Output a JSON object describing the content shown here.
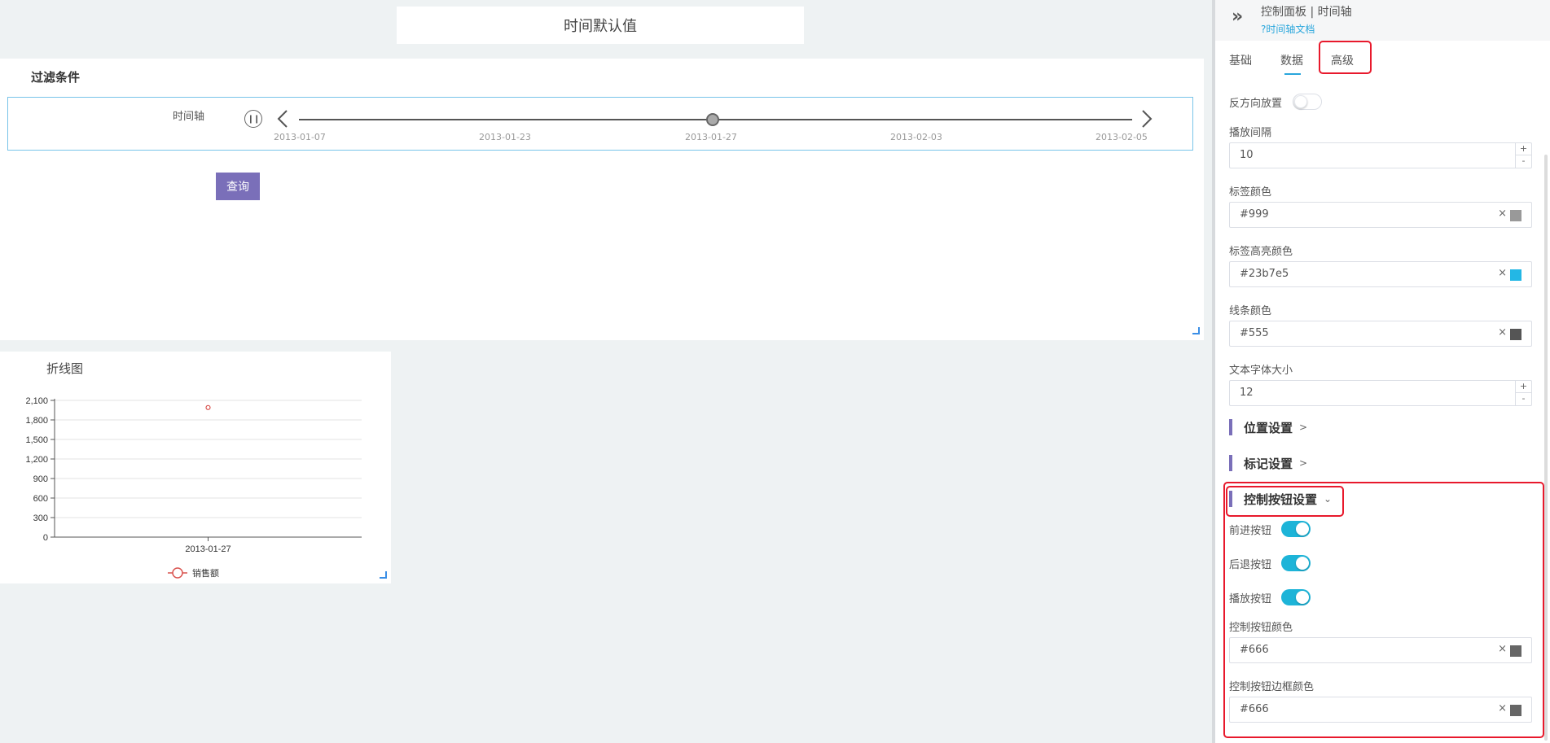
{
  "canvas": {
    "title": "时间默认值",
    "filter": {
      "title": "过滤条件",
      "timeline_label": "时间轴",
      "ticks": [
        "2013-01-07",
        "2013-01-23",
        "2013-01-27",
        "2013-02-03",
        "2013-02-05"
      ],
      "current_tick_index": 2,
      "query_button": "查询"
    },
    "chart": {
      "title": "折线图"
    }
  },
  "chart_data": {
    "type": "line",
    "categories": [
      "2013-01-27"
    ],
    "series": [
      {
        "name": "销售额",
        "values": [
          1990
        ],
        "color": "#d9534f"
      }
    ],
    "ylim": [
      0,
      2100
    ],
    "yticks": [
      0,
      300,
      600,
      900,
      1200,
      1500,
      1800,
      2100
    ],
    "ytick_labels": [
      "0",
      "300",
      "600",
      "900",
      "1,200",
      "1,500",
      "1,800",
      "2,100"
    ],
    "grid": true,
    "legend_position": "bottom"
  },
  "panel": {
    "title": "控制面板 | 时间轴",
    "doc_link": "?时间轴文档",
    "tabs": [
      "基础",
      "数据",
      "高级"
    ],
    "active_tab": "高级",
    "reverse_label": "反方向放置",
    "reverse_on": false,
    "interval_label": "播放间隔",
    "interval_value": "10",
    "label_color_label": "标签颜色",
    "label_color_value": "#999",
    "highlight_color_label": "标签高亮颜色",
    "highlight_color_value": "#23b7e5",
    "line_color_label": "线条颜色",
    "line_color_value": "#555",
    "font_size_label": "文本字体大小",
    "font_size_value": "12",
    "stepper_plus": "+",
    "stepper_minus": "-",
    "clear_glyph": "×",
    "section_position": "位置设置",
    "section_marker": "标记设置",
    "section_control": "控制按钮设置",
    "forward_label": "前进按钮",
    "forward_on": true,
    "backward_label": "后退按钮",
    "backward_on": true,
    "play_label": "播放按钮",
    "play_on": true,
    "btn_color_label": "控制按钮颜色",
    "btn_color_value": "#666",
    "btn_border_color_label": "控制按钮边框颜色",
    "btn_border_color_value": "#666"
  },
  "colors": {
    "accent": "#29a6dc",
    "query_button": "#7a6fb9",
    "toggle_on": "#1db4d8",
    "highlight_box": "#e8192c"
  }
}
